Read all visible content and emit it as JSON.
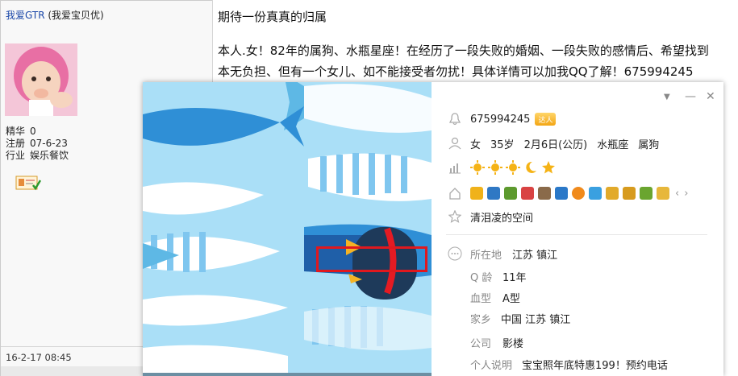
{
  "post": {
    "author_name": "我爱GTR",
    "author_nick": "(我爱宝贝优)",
    "stats": [
      {
        "label": "精华",
        "value": "0"
      },
      {
        "label": "注册",
        "value": "07-6-23"
      },
      {
        "label": "行业",
        "value": "娱乐餐饮"
      }
    ],
    "date": "16-2-17 08:45",
    "title": "期待一份真真的归属",
    "body_line1": "本人.女！82年的属狗、水瓶星座！在经历了一段失败的婚姻、一段失败的感情后、希望找到",
    "body_line2": "本无负担、但有一个女儿、如不能接受者勿扰！具体详情可以加我QQ了解！675994245"
  },
  "card": {
    "qq": "675994245",
    "vip_label": "达人",
    "gender": "女",
    "age": "35岁",
    "birthday": "2月6日(公历)",
    "zodiac": "水瓶座",
    "chinese_zodiac": "属狗",
    "space": "清泪凌的空间",
    "fields": [
      {
        "label": "所在地",
        "value": "江苏 镇江"
      },
      {
        "label": "Q 龄",
        "value": "11年"
      },
      {
        "label": "血型",
        "value": "A型"
      },
      {
        "label": "家乡",
        "value": "中国 江苏 镇江"
      },
      {
        "label": "公司",
        "value": "影楼"
      },
      {
        "label": "个人说明",
        "value": "宝宝照年底特惠199！预约电话"
      }
    ],
    "colors": {
      "cover_bg": "#aadff7",
      "highlight": "#e0181e",
      "level_icon": "#f5b316"
    }
  }
}
